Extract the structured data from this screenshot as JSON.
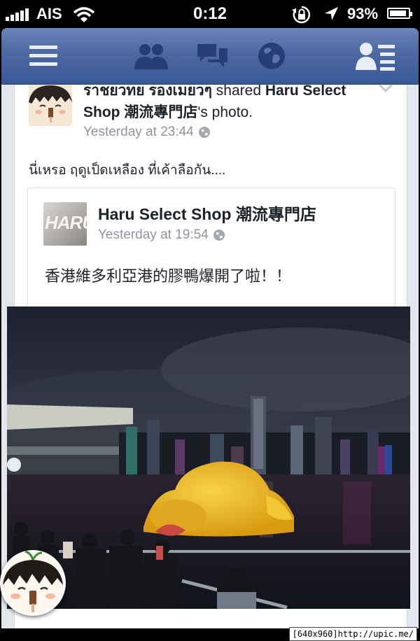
{
  "status_bar": {
    "carrier": "AIS",
    "time": "0:12",
    "battery_percent": "93%",
    "battery_level": 0.93,
    "icons": [
      "signal-bars-icon",
      "wifi-icon",
      "rotation-lock-icon",
      "location-arrow-icon",
      "battery-icon"
    ]
  },
  "navbar": {
    "icons": [
      "menu-icon",
      "friend-requests-icon",
      "messages-icon",
      "notifications-globe-icon",
      "friends-list-icon"
    ],
    "accent": "#3b5998"
  },
  "post": {
    "author": "ราชยวทย รองเมยวๆ",
    "shared_text": " shared ",
    "page_name": "Haru Select Shop 潮流專門店",
    "possessive": "'s photo.",
    "timestamp": "Yesterday at 23:44",
    "message": "นี่เหรอ ฤดูเป็ดเหลือง ที่เค้าลือกัน....",
    "shared_post": {
      "thumbnail_text": "HARU",
      "page_name": "Haru Select Shop 潮流專門店",
      "timestamp": "Yesterday at 19:54",
      "caption": "香港維多利亞港的膠鴨爆開了啦！！"
    }
  },
  "photo": {
    "description_icon": "rubber-duck-photo"
  },
  "chat_head": {
    "icon": "chat-head-avatar"
  },
  "watermark": "[640x960]http://upic.me/"
}
